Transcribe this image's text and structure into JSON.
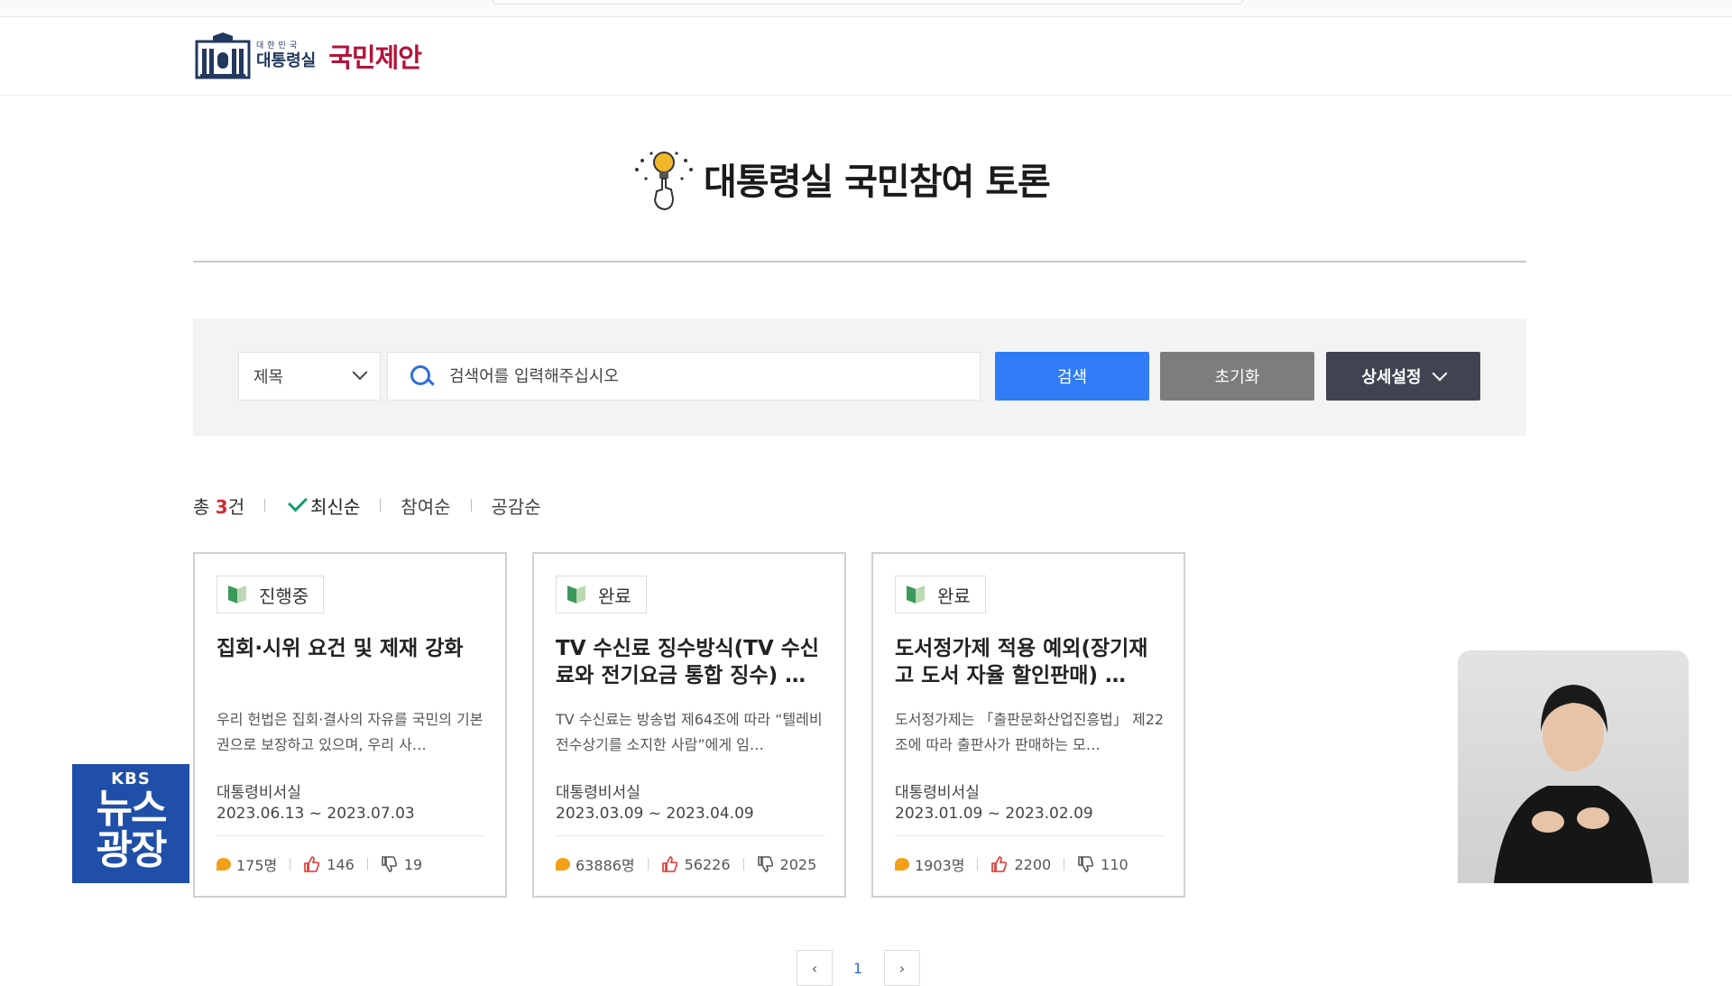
{
  "header": {
    "logo_tiny": "대한민국",
    "logo_office": "대통령실",
    "logo_main": "국민제안"
  },
  "page": {
    "title": "대통령실 국민참여 토론"
  },
  "search": {
    "field_select": "제목",
    "placeholder": "검색어를 입력해주십시오",
    "search_label": "검색",
    "reset_label": "초기화",
    "detail_label": "상세설정"
  },
  "sort": {
    "count_prefix": "총 ",
    "count": "3",
    "count_suffix": "건",
    "options": [
      "최신순",
      "참여순",
      "공감순"
    ]
  },
  "cards": [
    {
      "status": "진행중",
      "title": "집회·시위 요건 및 제재 강화",
      "desc": "우리 헌법은 집회·결사의 자유를 국민의 기본권으로 보장하고 있으며, 우리 사…",
      "dept": "대통령비서실",
      "period": "2023.06.13 ~ 2023.07.03",
      "participants": "175명",
      "likes": "146",
      "dislikes": "19"
    },
    {
      "status": "완료",
      "title": "TV 수신료 징수방식(TV 수신료와 전기요금 통합 징수) …",
      "desc": "TV 수신료는 방송법 제64조에 따라 “텔레비전수상기를 소지한 사람”에게 임…",
      "dept": "대통령비서실",
      "period": "2023.03.09 ~ 2023.04.09",
      "participants": "63886명",
      "likes": "56226",
      "dislikes": "2025"
    },
    {
      "status": "완료",
      "title": "도서정가제 적용 예외(장기재고 도서 자율 할인판매) …",
      "desc": "도서정가제는 「출판문화산업진흥법」 제22조에 따라 출판사가 판매하는 모…",
      "dept": "대통령비서실",
      "period": "2023.01.09 ~ 2023.02.09",
      "participants": "1903명",
      "likes": "2200",
      "dislikes": "110"
    }
  ],
  "pagination": {
    "prev": "‹",
    "current": "1",
    "next": "›"
  },
  "overlay": {
    "network": "KBS",
    "program_line1": "뉴스",
    "program_line2": "광장"
  },
  "colors": {
    "brand_red": "#b3133a",
    "brand_navy": "#22385e",
    "search_blue": "#2f7cf6",
    "count_red": "#d12a32"
  }
}
